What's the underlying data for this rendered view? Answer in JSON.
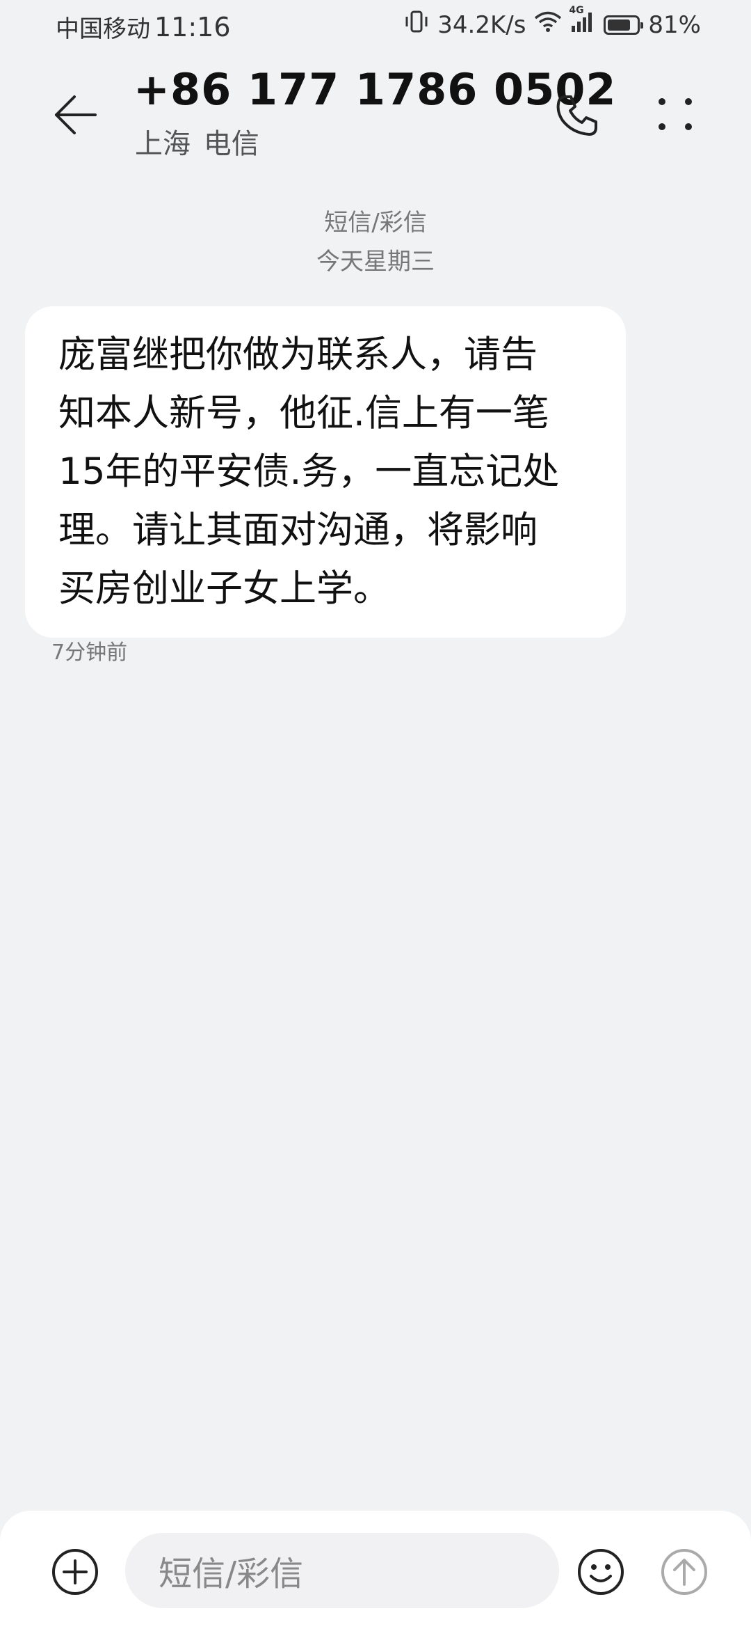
{
  "status_bar": {
    "carrier": "中国移动",
    "time": "11:16",
    "vibrate_icon": "vibrate-icon",
    "network_speed": "34.2K/s",
    "wifi_icon": "wifi-icon",
    "network_type": "4G",
    "signal_icon": "signal-icon",
    "battery_icon": "battery-icon",
    "battery_level": 0.81,
    "battery_percent": "81%"
  },
  "header": {
    "back_icon": "back-arrow-icon",
    "contact_number": "+86 177 1786 0502",
    "contact_location": "上海 电信",
    "call_icon": "phone-icon",
    "more_icon": "more-vertical-icon"
  },
  "conversation": {
    "message_type": "短信/彩信",
    "date_label": "今天星期三",
    "messages": [
      {
        "direction": "incoming",
        "lines": [
          "庞富继把你做为联系人，请告",
          "知本人新号，他征.信上有一笔",
          "15年的平安债.务，一直忘记处",
          "理。请让其面对沟通，将影响",
          "买房创业子女上学。"
        ],
        "time": "7分钟前"
      }
    ]
  },
  "input_bar": {
    "add_icon": "add-circle-icon",
    "placeholder": "短信/彩信",
    "emoji_icon": "emoji-icon",
    "send_icon": "send-arrow-icon"
  },
  "colors": {
    "background": "#f1f2f4",
    "bubble": "#ffffff",
    "text_primary": "#111111",
    "text_secondary": "#777777"
  }
}
